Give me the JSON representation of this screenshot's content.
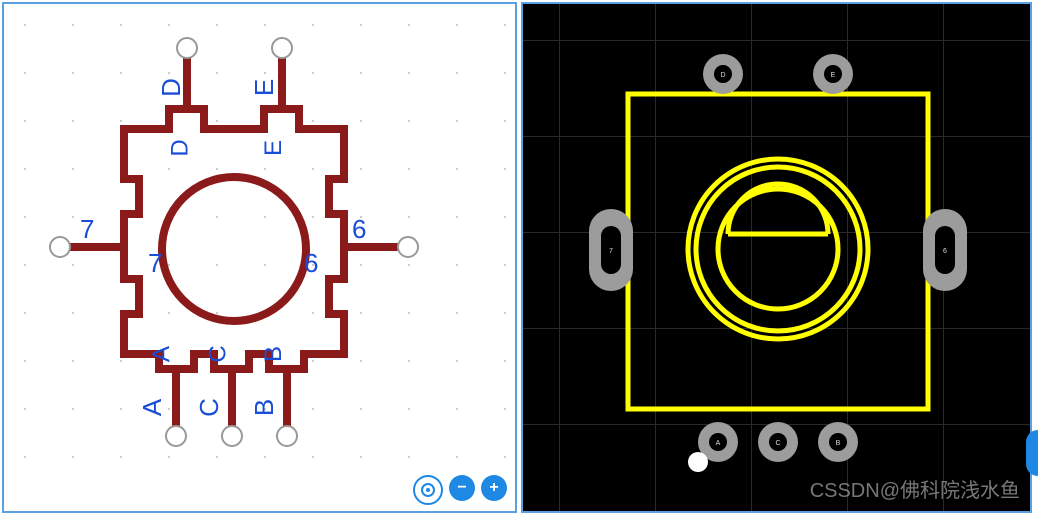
{
  "schematic": {
    "color": "#8b1a1a",
    "pin_circle": "#888888",
    "label_color": "#1a4dd6",
    "pins_top": [
      "D",
      "E"
    ],
    "pins_bottom": [
      "A",
      "C",
      "B"
    ],
    "pins_left": [
      "7"
    ],
    "pins_right": [
      "6"
    ],
    "inner_labels": {
      "left_top": "D",
      "right_top": "E",
      "left_num": "7",
      "right_num": "6",
      "bottom_a": "A",
      "bottom_c": "C",
      "bottom_b": "B"
    }
  },
  "footprint": {
    "outline_color": "#ffff00",
    "pad_color": "#9c9c9c",
    "pads_top": [
      "D",
      "E"
    ],
    "pads_bottom": [
      "A",
      "C",
      "B"
    ],
    "pads_left": [
      "7"
    ],
    "pads_right": [
      "6"
    ],
    "origin_marker": true
  },
  "controls": {
    "target": "target-icon",
    "zoom_out": "−",
    "zoom_in": "+"
  },
  "watermark": "CSSDN@佛科院浅水鱼"
}
